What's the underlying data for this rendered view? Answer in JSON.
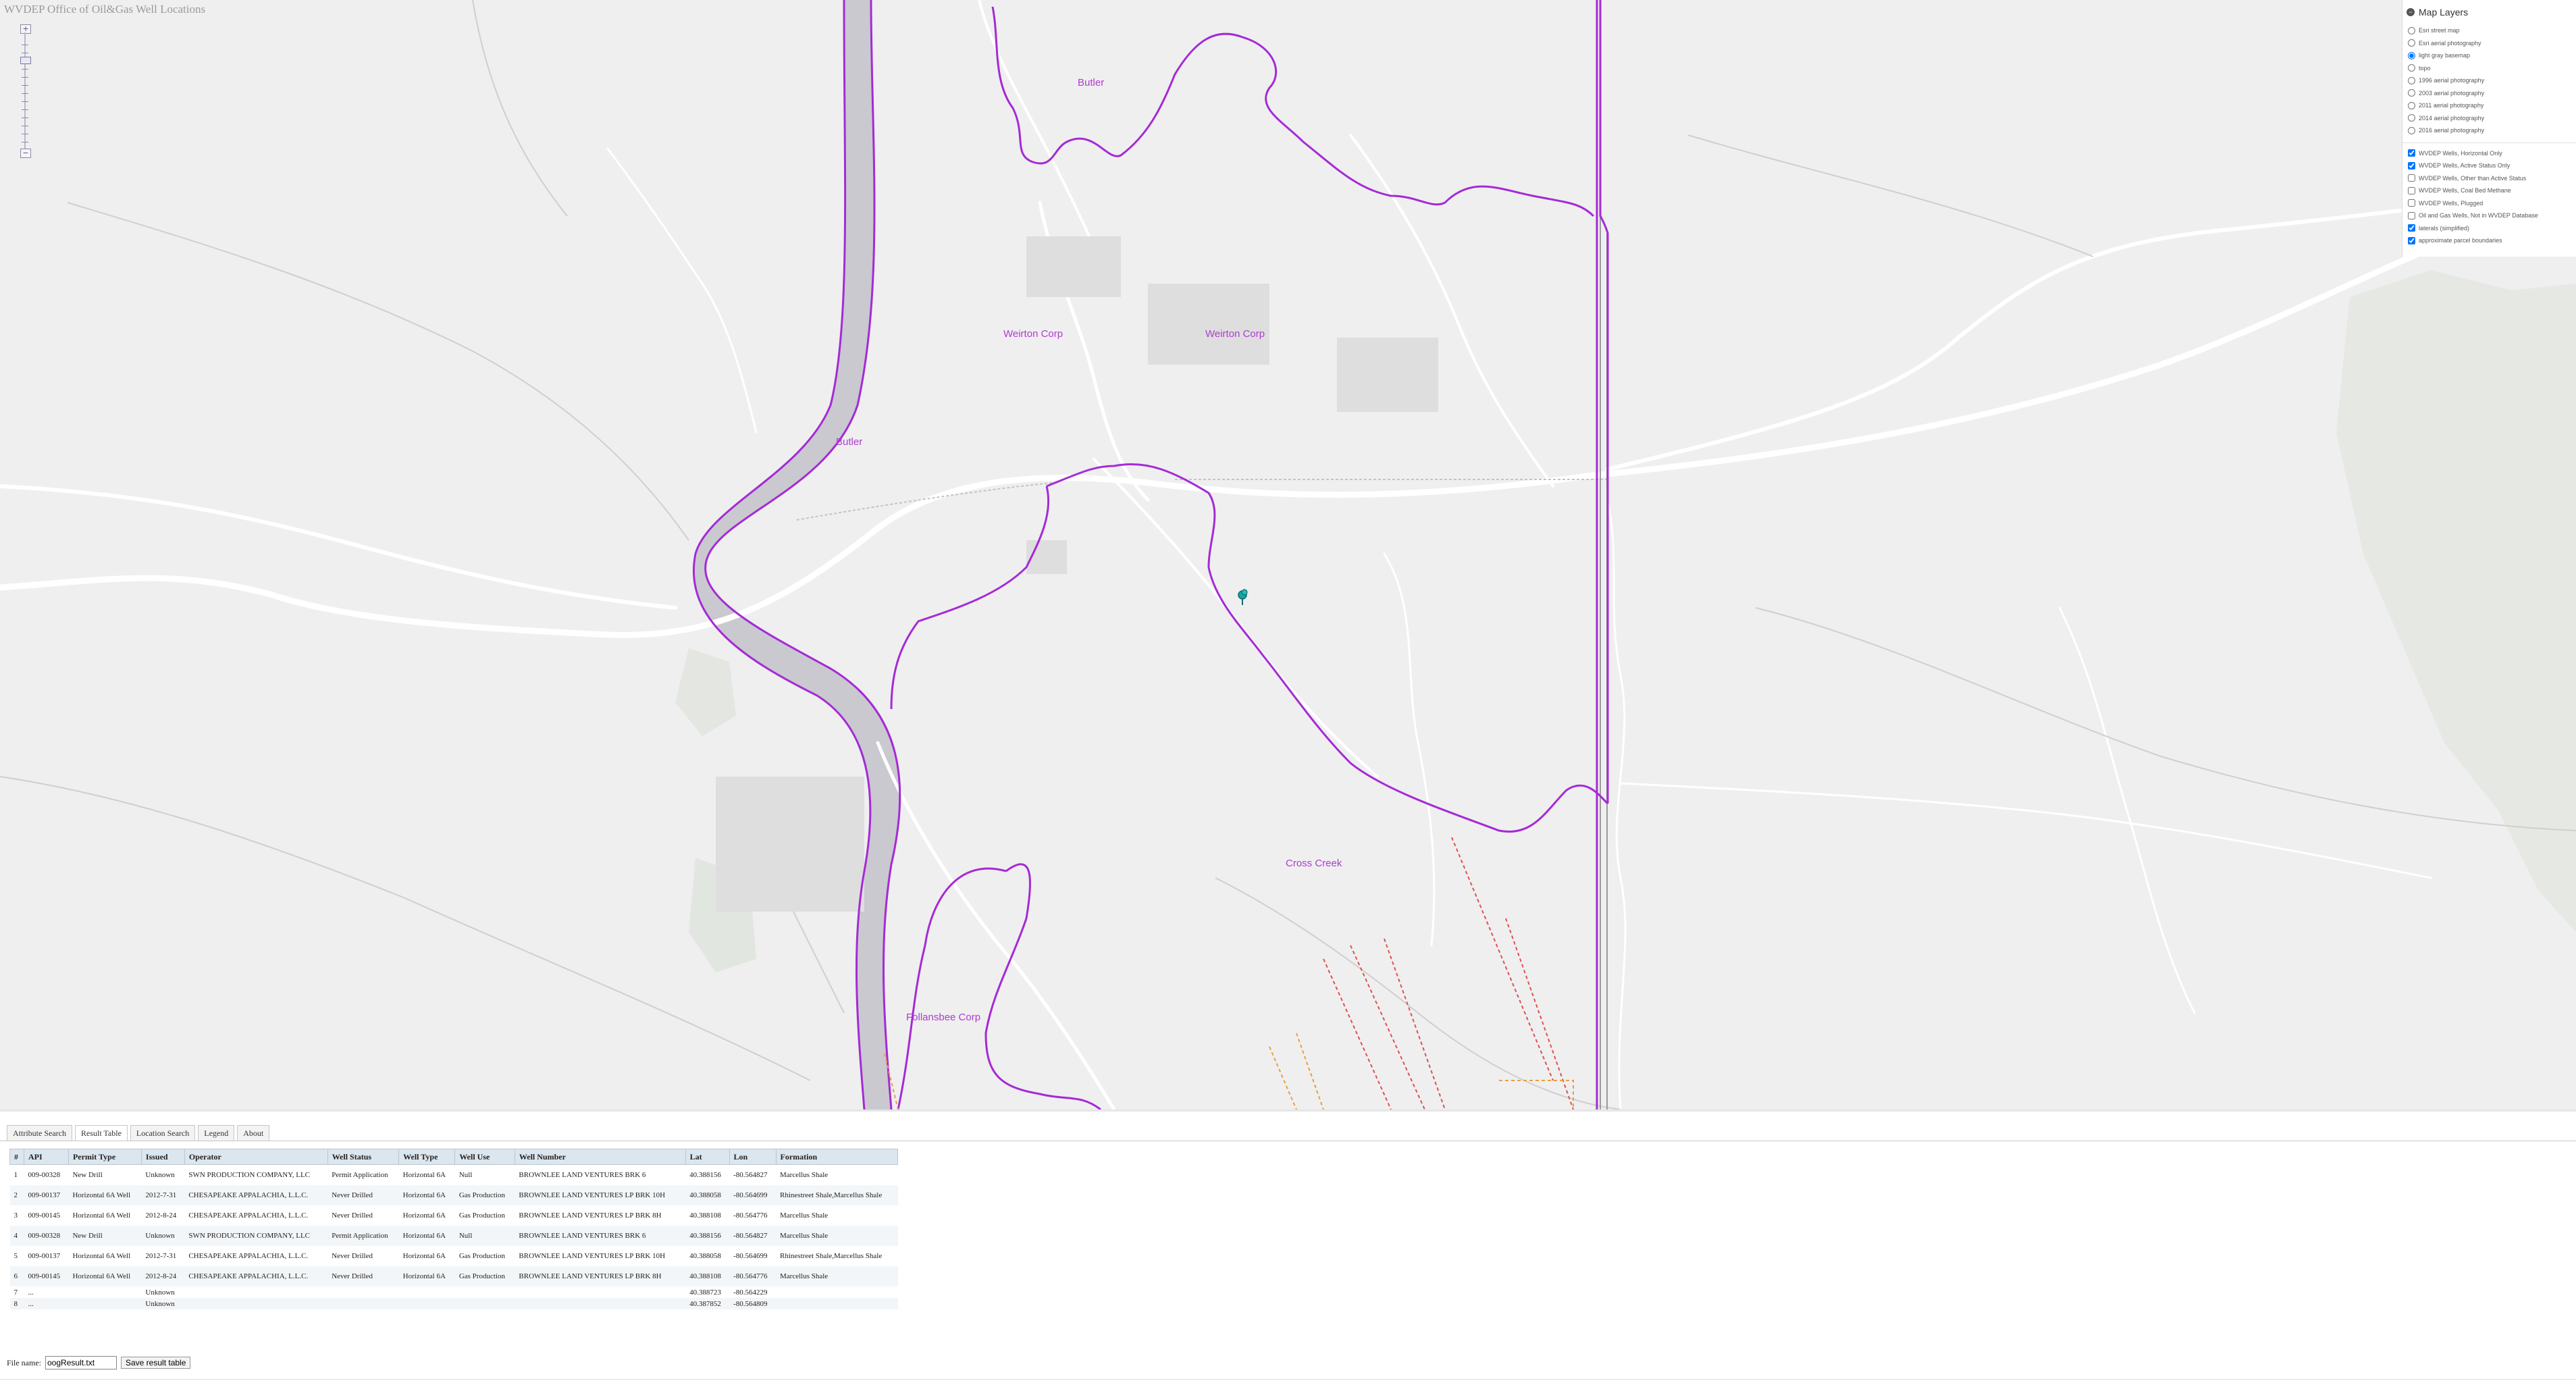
{
  "app": {
    "title": "WVDEP Office of Oil&Gas Well Locations"
  },
  "map": {
    "labels": [
      {
        "id": "butler-north",
        "text": "Butler"
      },
      {
        "id": "butler-river",
        "text": "Butler"
      },
      {
        "id": "weirton-west",
        "text": "Weirton Corp"
      },
      {
        "id": "weirton-east",
        "text": "Weirton Corp"
      },
      {
        "id": "cross-creek",
        "text": "Cross Creek"
      },
      {
        "id": "follansbee",
        "text": "Follansbee Corp"
      }
    ],
    "boundary_color": "#a52ad6",
    "well_marker_color": "#1aa3a3"
  },
  "layers": {
    "title": "Map Layers",
    "basemaps": [
      {
        "label": "Esri street map",
        "selected": false
      },
      {
        "label": "Esri aerial photography",
        "selected": false
      },
      {
        "label": "light gray basemap",
        "selected": true
      },
      {
        "label": "topo",
        "selected": false
      },
      {
        "label": "1996 aerial photography",
        "selected": false
      },
      {
        "label": "2003 aerial photography",
        "selected": false
      },
      {
        "label": "2011 aerial photography",
        "selected": false
      },
      {
        "label": "2014 aerial photography",
        "selected": false
      },
      {
        "label": "2016 aerial photography",
        "selected": false
      }
    ],
    "overlays": [
      {
        "label": "WVDEP Wells, Horizontal Only",
        "checked": true
      },
      {
        "label": "WVDEP Wells, Active Status Only",
        "checked": true
      },
      {
        "label": "WVDEP Wells, Other than Active Status",
        "checked": false
      },
      {
        "label": "WVDEP Wells, Coal Bed Methane",
        "checked": false
      },
      {
        "label": "WVDEP Wells, Plugged",
        "checked": false
      },
      {
        "label": "Oil and Gas Wells, Not in WVDEP Database",
        "checked": false
      },
      {
        "label": "laterals (simplified)",
        "checked": true
      },
      {
        "label": "approximate parcel boundaries",
        "checked": true
      }
    ]
  },
  "tabs": [
    {
      "label": "Attribute Search",
      "active": false
    },
    {
      "label": "Result Table",
      "active": true
    },
    {
      "label": "Location Search",
      "active": false
    },
    {
      "label": "Legend",
      "active": false
    },
    {
      "label": "About",
      "active": false
    }
  ],
  "results": {
    "columns": [
      "#",
      "API",
      "Permit Type",
      "Issued",
      "Operator",
      "Well Status",
      "Well Type",
      "Well Use",
      "Well Number",
      "Lat",
      "Lon",
      "Formation"
    ],
    "rows": [
      [
        "1",
        "009-00328",
        "New Drill",
        "Unknown",
        "SWN PRODUCTION COMPANY, LLC",
        "Permit Application",
        "Horizontal 6A",
        "Null",
        "BROWNLEE LAND VENTURES BRK 6",
        "40.388156",
        "-80.564827",
        "Marcellus Shale"
      ],
      [
        "2",
        "009-00137",
        "Horizontal 6A Well",
        "2012-7-31",
        "CHESAPEAKE APPALACHIA, L.L.C.",
        "Never Drilled",
        "Horizontal 6A",
        "Gas Production",
        "BROWNLEE LAND VENTURES LP BRK 10H",
        "40.388058",
        "-80.564699",
        "Rhinestreet Shale,Marcellus Shale"
      ],
      [
        "3",
        "009-00145",
        "Horizontal 6A Well",
        "2012-8-24",
        "CHESAPEAKE APPALACHIA, L.L.C.",
        "Never Drilled",
        "Horizontal 6A",
        "Gas Production",
        "BROWNLEE LAND VENTURES LP BRK 8H",
        "40.388108",
        "-80.564776",
        "Marcellus Shale"
      ],
      [
        "4",
        "009-00328",
        "New Drill",
        "Unknown",
        "SWN PRODUCTION COMPANY, LLC",
        "Permit Application",
        "Horizontal 6A",
        "Null",
        "BROWNLEE LAND VENTURES BRK 6",
        "40.388156",
        "-80.564827",
        "Marcellus Shale"
      ],
      [
        "5",
        "009-00137",
        "Horizontal 6A Well",
        "2012-7-31",
        "CHESAPEAKE APPALACHIA, L.L.C.",
        "Never Drilled",
        "Horizontal 6A",
        "Gas Production",
        "BROWNLEE LAND VENTURES LP BRK 10H",
        "40.388058",
        "-80.564699",
        "Rhinestreet Shale,Marcellus Shale"
      ],
      [
        "6",
        "009-00145",
        "Horizontal 6A Well",
        "2012-8-24",
        "CHESAPEAKE APPALACHIA, L.L.C.",
        "Never Drilled",
        "Horizontal 6A",
        "Gas Production",
        "BROWNLEE LAND VENTURES LP BRK 8H",
        "40.388108",
        "-80.564776",
        "Marcellus Shale"
      ],
      [
        "7",
        "...",
        "",
        "Unknown",
        "",
        "",
        "",
        "",
        "",
        "40.388723",
        "-80.564229",
        ""
      ],
      [
        "8",
        "...",
        "",
        "Unknown",
        "",
        "",
        "",
        "",
        "",
        "40.387852",
        "-80.564809",
        ""
      ]
    ]
  },
  "save": {
    "file_label": "File name:",
    "file_value": "oogResult.txt",
    "button_label": "Save result table"
  }
}
